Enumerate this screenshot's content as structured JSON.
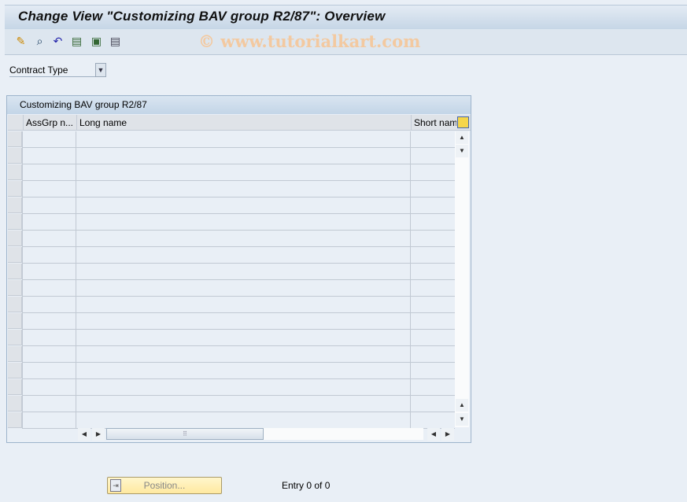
{
  "title": "Change View \"Customizing BAV group R2/87\": Overview",
  "watermark": "© www.tutorialkart.com",
  "toolbar": {
    "icons": [
      "display-change-icon",
      "select-icon",
      "undo-icon",
      "select-all-icon",
      "select-block-icon",
      "deselect-all-icon"
    ]
  },
  "filter": {
    "label": "Contract Type"
  },
  "table": {
    "title": "Customizing BAV group R2/87",
    "columns": [
      "AssGrp n...",
      "Long name",
      "Short nam"
    ],
    "row_count": 18,
    "rows": []
  },
  "footer": {
    "position_label": "Position...",
    "entry_text": "Entry 0 of 0"
  },
  "colors": {
    "title_bg": "#c6d6e6",
    "button_bg": "#ffe9a0",
    "background": "#e9eff6"
  }
}
